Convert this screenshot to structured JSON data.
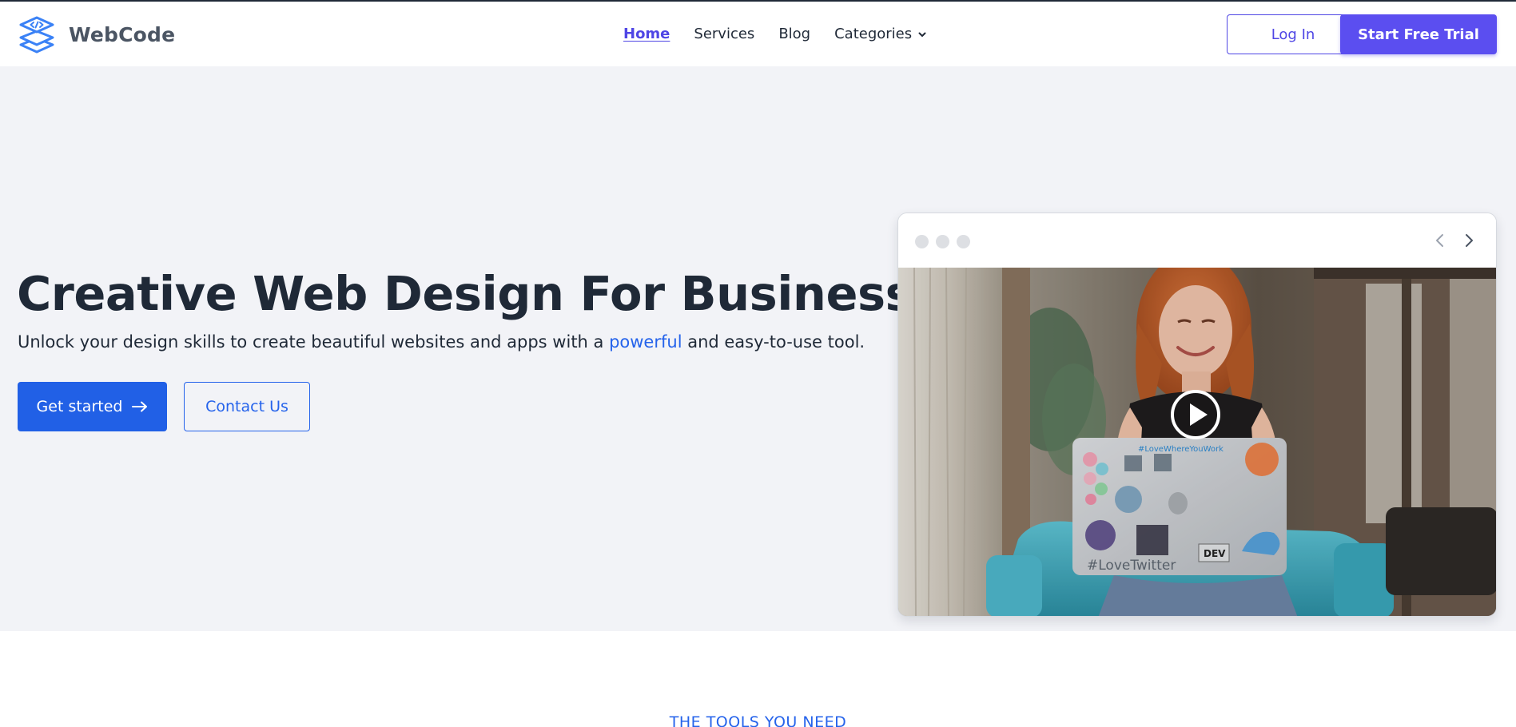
{
  "brand": {
    "name": "WebCode",
    "logo_icon": "layers-code-icon"
  },
  "nav": {
    "items": [
      {
        "label": "Home",
        "active": true
      },
      {
        "label": "Services",
        "active": false
      },
      {
        "label": "Blog",
        "active": false
      },
      {
        "label": "Categories",
        "active": false,
        "dropdown": true
      }
    ]
  },
  "header_actions": {
    "login_label": "Log In",
    "trial_label": "Start Free Trial"
  },
  "hero": {
    "title": "Creative Web Design For Businesses",
    "subtitle_before": "Unlock your design skills to create beautiful websites and apps with a ",
    "subtitle_highlight": "powerful",
    "subtitle_after": " and easy-to-use tool.",
    "primary_cta": "Get started",
    "primary_cta_icon": "arrow-right-icon",
    "secondary_cta": "Contact Us"
  },
  "mockup": {
    "window_dots": 3,
    "prev_icon": "chevron-left-icon",
    "next_icon": "chevron-right-icon",
    "media_icon": "play-icon",
    "laptop_sticker_text": "#LoveTwitter",
    "laptop_top_text": "#LoveWhereYouWork",
    "laptop_badge_text": "DEV"
  },
  "section": {
    "eyebrow": "THE TOOLS YOU NEED"
  },
  "colors": {
    "brand_purple": "#5b4ef0",
    "primary_blue": "#2160e6",
    "hero_bg": "#f2f3f7",
    "text_dark": "#1f2937"
  }
}
